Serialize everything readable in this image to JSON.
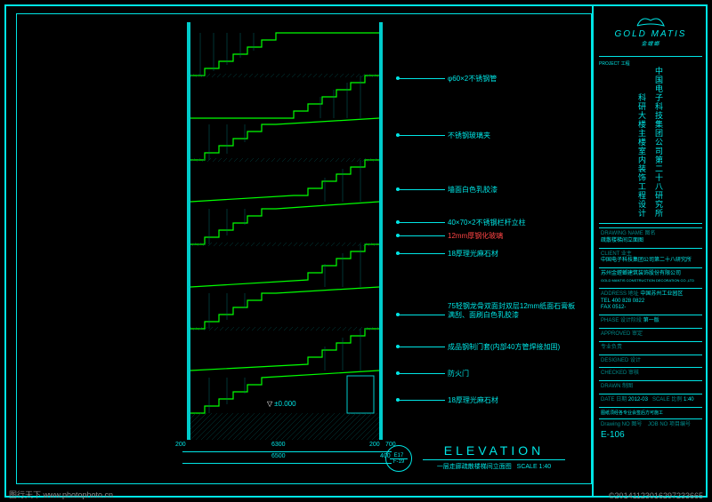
{
  "titleblock": {
    "logo": "GOLD MATIS",
    "logo_ch": "金螳螂",
    "project_label": "PROJECT 工程",
    "project_line1": "科研大楼主楼室内装饰工程设计",
    "project_line2": "中国电子科技集团公司第二十八研究所",
    "drawing_label": "DRAWING NAME 图名",
    "drawing_name": "疏散楼梯间立面图",
    "client_label": "CLIENT 业主",
    "client": "中国电子科技集团公司第二十八研究所",
    "company": "苏州金螳螂建筑装饰股份有限公司",
    "company_en": "GOLD MANTIS CONSTRUCTION DECORATION CO.,LTD",
    "addr1": "ADDRESS 地址",
    "addr2": "中国苏州工业园区",
    "tel": "400 828 0822",
    "fax": "0512-",
    "phase_label": "PHASE 设计阶段",
    "phase": "第一版",
    "approved": "APPROVED 审定",
    "designed": "DESIGNED 设计",
    "checked": "CHECKED 审核",
    "drawn": "DRAWN 制图",
    "resp": "专业负责",
    "date_label": "DATE 日期",
    "date": "2012-03",
    "scale_label": "SCALE 比例",
    "scale": "1:40",
    "dwg_no_label": "Drawing NO 图号",
    "dwg_no": "E-106",
    "job_no_label": "JOB NO 项目编号",
    "notes": "图纸须经各专业会签后方可施工"
  },
  "annotations": {
    "a1": "φ60×2不锈钢管",
    "a2": "不锈钢玻璃夹",
    "a3": "墙面白色乳胶漆",
    "a4": "40×70×2不锈钢栏杆立柱",
    "a5": "12mm厚钢化玻璃",
    "a6": "18厚理光麻石材",
    "a7": "75轻钢龙骨双面封双层12mm纸面石膏板 满刮、面刷白色乳胶漆",
    "a8": "成品钢制门套(内部40方管焊接加固)",
    "a9": "防火门",
    "a10": "18厚理光麻石材"
  },
  "level": {
    "ground": "±0.000"
  },
  "dims": {
    "left": "200",
    "large": "6300",
    "large2": "6500",
    "right1": "200",
    "right2": "700",
    "total": "400"
  },
  "elevation": {
    "id_top": "E17",
    "id_bot": "F-19",
    "title": "ELEVATION",
    "sub": "一层走廊疏散楼梯间立面图",
    "scale": "SCALE 1:40"
  },
  "watermark": {
    "left": "图行天下 www.photophoto.cn",
    "right": "©20141123016297233665"
  }
}
